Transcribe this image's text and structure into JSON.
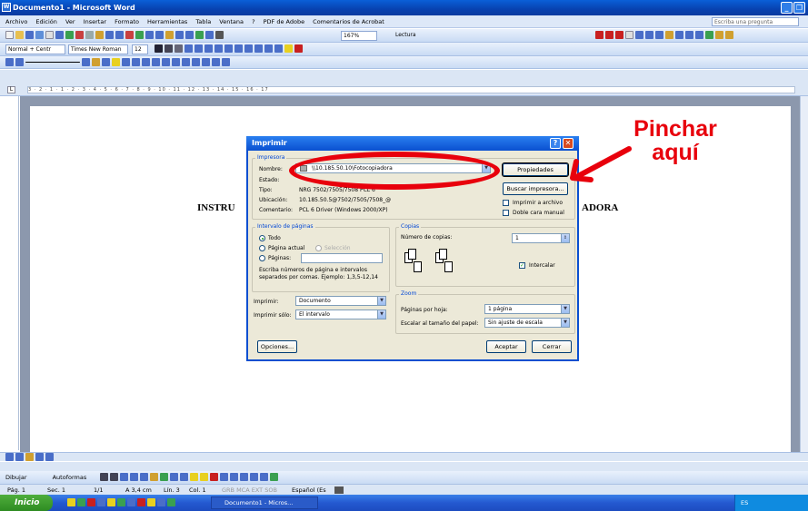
{
  "window": {
    "title": "Documento1 - Microsoft Word"
  },
  "menu": [
    "Archivo",
    "Edición",
    "Ver",
    "Insertar",
    "Formato",
    "Herramientas",
    "Tabla",
    "Ventana",
    "?",
    "PDF de Adobe",
    "Comentarios de Acrobat"
  ],
  "ask_placeholder": "Escriba una pregunta",
  "toolbar": {
    "zoom": "167%",
    "reading": "Lectura",
    "style": "Normal + Centr",
    "font": "Times New Roman",
    "size": "12"
  },
  "ruler_text": "3 · 2 · 1 · 1 · 2 · 3 · 4 · 5 · 6 · 7 · 8 · 9 · 10 · 11 · 12 · 13 · 14 · 15 · 16 · 17",
  "document": {
    "left_text": "INSTRU",
    "right_text": "ADORA"
  },
  "dialog": {
    "title": "Imprimir",
    "printer_group": "Impresora",
    "name_label": "Nombre:",
    "name_value": "\\\\10.185.50.10\\Fotocopiadora",
    "status_label": "Estado:",
    "type_label": "Tipo:",
    "type_value": "NRG 7502/7505/7508 PCL 6",
    "location_label": "Ubicación:",
    "location_value": "10.185.50.5@7502/7505/7508_@",
    "comment_label": "Comentario:",
    "comment_value": "PCL 6 Driver (Windows 2000/XP)",
    "properties_btn": "Propiedades",
    "find_printer_btn": "Buscar impresora...",
    "print_to_file": "Imprimir a archivo",
    "duplex": "Doble cara manual",
    "range_group": "Intervalo de páginas",
    "all": "Todo",
    "current_page": "Página actual",
    "selection": "Selección",
    "pages": "Páginas:",
    "range_hint": "Escriba números de página e intervalos separados por comas. Ejemplo: 1,3,5-12,14",
    "copies_group": "Copias",
    "copies_label": "Número de copias:",
    "copies_value": "1",
    "collate": "Intercalar",
    "print_label": "Imprimir:",
    "print_value": "Documento",
    "print_only_label": "Imprimir sólo:",
    "print_only_value": "El intervalo",
    "zoom_group": "Zoom",
    "pages_per_sheet_label": "Páginas por hoja:",
    "pages_per_sheet_value": "1 página",
    "scale_label": "Escalar al tamaño del papel:",
    "scale_value": "Sin ajuste de escala",
    "options_btn": "Opciones...",
    "accept_btn": "Aceptar",
    "close_btn": "Cerrar"
  },
  "annotation": {
    "line1": "Pinchar",
    "line2": "aquí"
  },
  "drawing_toolbar": {
    "draw": "Dibujar",
    "autoshapes": "Autoformas"
  },
  "status": {
    "page": "Pág. 1",
    "section": "Sec. 1",
    "pages": "1/1",
    "at": "A 3,4 cm",
    "line": "Lín. 3",
    "col": "Col. 1",
    "modes": "GRB  MCA  EXT  SOB",
    "lang": "Español (Es"
  },
  "taskbar": {
    "start": "Inicio",
    "task": "Documento1 - Micros...",
    "lang": "ES"
  },
  "colors": {
    "annotation_red": "#e8000c",
    "xp_blue": "#0a4fd0"
  }
}
